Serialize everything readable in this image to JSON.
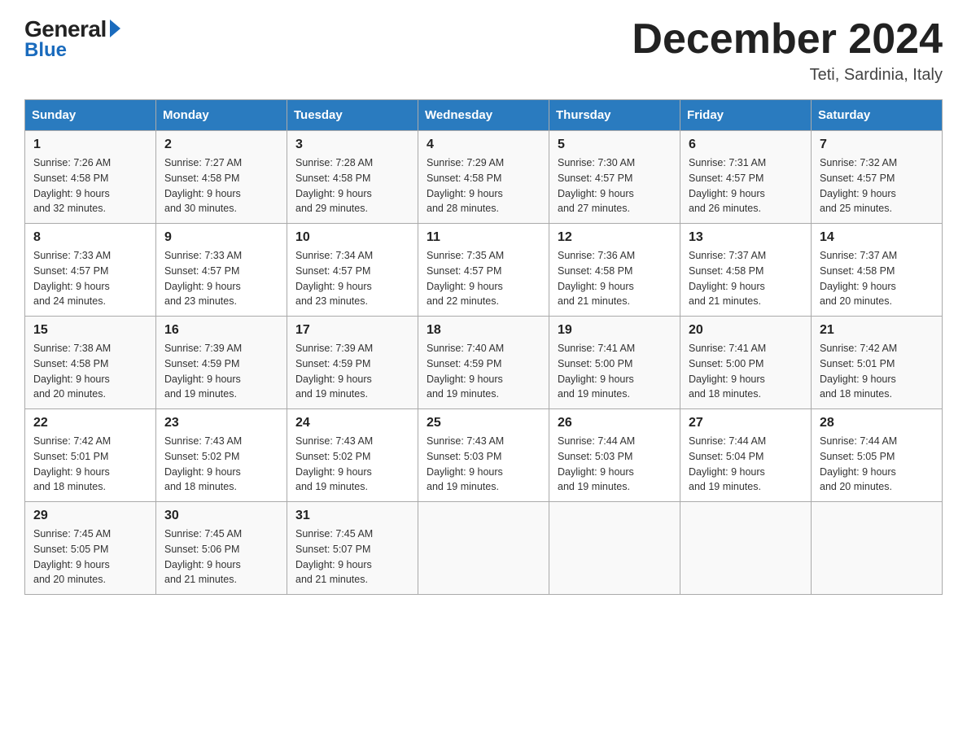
{
  "header": {
    "logo_general": "General",
    "logo_blue": "Blue",
    "month_title": "December 2024",
    "location": "Teti, Sardinia, Italy"
  },
  "days_of_week": [
    "Sunday",
    "Monday",
    "Tuesday",
    "Wednesday",
    "Thursday",
    "Friday",
    "Saturday"
  ],
  "weeks": [
    [
      {
        "day": "1",
        "sunrise": "7:26 AM",
        "sunset": "4:58 PM",
        "daylight": "9 hours and 32 minutes."
      },
      {
        "day": "2",
        "sunrise": "7:27 AM",
        "sunset": "4:58 PM",
        "daylight": "9 hours and 30 minutes."
      },
      {
        "day": "3",
        "sunrise": "7:28 AM",
        "sunset": "4:58 PM",
        "daylight": "9 hours and 29 minutes."
      },
      {
        "day": "4",
        "sunrise": "7:29 AM",
        "sunset": "4:58 PM",
        "daylight": "9 hours and 28 minutes."
      },
      {
        "day": "5",
        "sunrise": "7:30 AM",
        "sunset": "4:57 PM",
        "daylight": "9 hours and 27 minutes."
      },
      {
        "day": "6",
        "sunrise": "7:31 AM",
        "sunset": "4:57 PM",
        "daylight": "9 hours and 26 minutes."
      },
      {
        "day": "7",
        "sunrise": "7:32 AM",
        "sunset": "4:57 PM",
        "daylight": "9 hours and 25 minutes."
      }
    ],
    [
      {
        "day": "8",
        "sunrise": "7:33 AM",
        "sunset": "4:57 PM",
        "daylight": "9 hours and 24 minutes."
      },
      {
        "day": "9",
        "sunrise": "7:33 AM",
        "sunset": "4:57 PM",
        "daylight": "9 hours and 23 minutes."
      },
      {
        "day": "10",
        "sunrise": "7:34 AM",
        "sunset": "4:57 PM",
        "daylight": "9 hours and 23 minutes."
      },
      {
        "day": "11",
        "sunrise": "7:35 AM",
        "sunset": "4:57 PM",
        "daylight": "9 hours and 22 minutes."
      },
      {
        "day": "12",
        "sunrise": "7:36 AM",
        "sunset": "4:58 PM",
        "daylight": "9 hours and 21 minutes."
      },
      {
        "day": "13",
        "sunrise": "7:37 AM",
        "sunset": "4:58 PM",
        "daylight": "9 hours and 21 minutes."
      },
      {
        "day": "14",
        "sunrise": "7:37 AM",
        "sunset": "4:58 PM",
        "daylight": "9 hours and 20 minutes."
      }
    ],
    [
      {
        "day": "15",
        "sunrise": "7:38 AM",
        "sunset": "4:58 PM",
        "daylight": "9 hours and 20 minutes."
      },
      {
        "day": "16",
        "sunrise": "7:39 AM",
        "sunset": "4:59 PM",
        "daylight": "9 hours and 19 minutes."
      },
      {
        "day": "17",
        "sunrise": "7:39 AM",
        "sunset": "4:59 PM",
        "daylight": "9 hours and 19 minutes."
      },
      {
        "day": "18",
        "sunrise": "7:40 AM",
        "sunset": "4:59 PM",
        "daylight": "9 hours and 19 minutes."
      },
      {
        "day": "19",
        "sunrise": "7:41 AM",
        "sunset": "5:00 PM",
        "daylight": "9 hours and 19 minutes."
      },
      {
        "day": "20",
        "sunrise": "7:41 AM",
        "sunset": "5:00 PM",
        "daylight": "9 hours and 18 minutes."
      },
      {
        "day": "21",
        "sunrise": "7:42 AM",
        "sunset": "5:01 PM",
        "daylight": "9 hours and 18 minutes."
      }
    ],
    [
      {
        "day": "22",
        "sunrise": "7:42 AM",
        "sunset": "5:01 PM",
        "daylight": "9 hours and 18 minutes."
      },
      {
        "day": "23",
        "sunrise": "7:43 AM",
        "sunset": "5:02 PM",
        "daylight": "9 hours and 18 minutes."
      },
      {
        "day": "24",
        "sunrise": "7:43 AM",
        "sunset": "5:02 PM",
        "daylight": "9 hours and 19 minutes."
      },
      {
        "day": "25",
        "sunrise": "7:43 AM",
        "sunset": "5:03 PM",
        "daylight": "9 hours and 19 minutes."
      },
      {
        "day": "26",
        "sunrise": "7:44 AM",
        "sunset": "5:03 PM",
        "daylight": "9 hours and 19 minutes."
      },
      {
        "day": "27",
        "sunrise": "7:44 AM",
        "sunset": "5:04 PM",
        "daylight": "9 hours and 19 minutes."
      },
      {
        "day": "28",
        "sunrise": "7:44 AM",
        "sunset": "5:05 PM",
        "daylight": "9 hours and 20 minutes."
      }
    ],
    [
      {
        "day": "29",
        "sunrise": "7:45 AM",
        "sunset": "5:05 PM",
        "daylight": "9 hours and 20 minutes."
      },
      {
        "day": "30",
        "sunrise": "7:45 AM",
        "sunset": "5:06 PM",
        "daylight": "9 hours and 21 minutes."
      },
      {
        "day": "31",
        "sunrise": "7:45 AM",
        "sunset": "5:07 PM",
        "daylight": "9 hours and 21 minutes."
      },
      null,
      null,
      null,
      null
    ]
  ],
  "labels": {
    "sunrise_label": "Sunrise:",
    "sunset_label": "Sunset:",
    "daylight_label": "Daylight:"
  }
}
